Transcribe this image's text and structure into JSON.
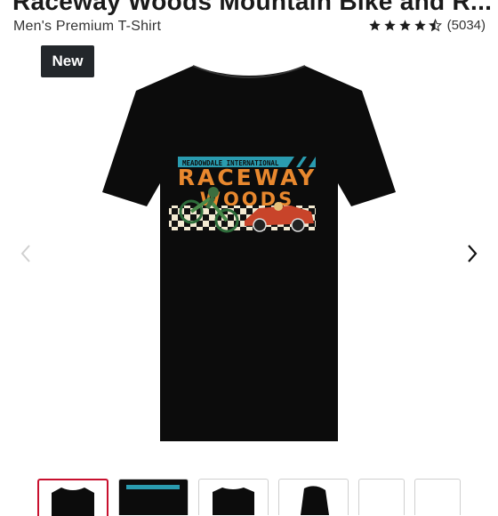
{
  "product": {
    "title": "Raceway Woods Mountain Bike and R...",
    "subtitle": "Men's Premium T-Shirt",
    "rating": {
      "stars": 4.5,
      "count_text": "(5034)"
    },
    "badge": "New"
  },
  "design": {
    "banner_text": "MEADOWDALE INTERNATIONAL",
    "line1": "RACEWAY",
    "line2": "WOODS"
  },
  "colors": {
    "shirt": "#0c0c0c",
    "accent_teal": "#2a9cb0",
    "accent_orange": "#e8882e",
    "badge_bg": "#23272b",
    "selected_thumb": "#c8102e"
  },
  "gallery": {
    "prev_icon": "chevron-left-icon",
    "next_icon": "chevron-right-icon",
    "thumbnails": [
      {
        "label": "front",
        "selected": true
      },
      {
        "label": "design closeup",
        "selected": false
      },
      {
        "label": "back",
        "selected": false
      },
      {
        "label": "side",
        "selected": false
      },
      {
        "label": "more-1",
        "selected": false
      },
      {
        "label": "more-2",
        "selected": false
      }
    ]
  }
}
